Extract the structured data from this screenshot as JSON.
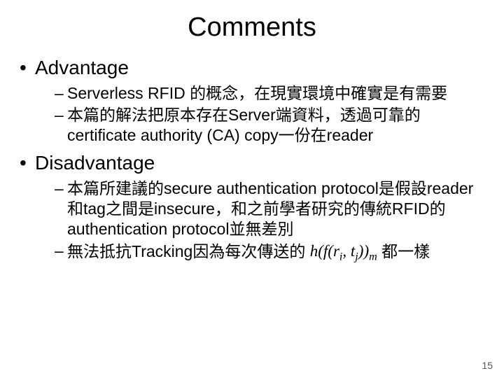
{
  "title": "Comments",
  "sections": {
    "advantage": {
      "heading": "Advantage",
      "items": [
        "Serverless RFID 的概念，在現實環境中確實是有需要",
        "本篇的解法把原本存在Server端資料，透過可靠的certificate authority (CA) copy一份在reader"
      ]
    },
    "disadvantage": {
      "heading": "Disadvantage",
      "items": [
        "本篇所建議的secure authentication protocol是假設reader和tag之間是insecure，和之前學者研究的傳統RFID的authentication protocol並無差別",
        "無法抵抗Tracking因為每次傳送的"
      ],
      "formula_tail": "都一樣"
    }
  },
  "formula": {
    "outer_fn": "h",
    "inner_fn": "f",
    "arg1_base": "r",
    "arg1_sub": "i",
    "arg2_base": "t",
    "arg2_sub": "j",
    "sub_m": "m"
  },
  "page_number": "15"
}
